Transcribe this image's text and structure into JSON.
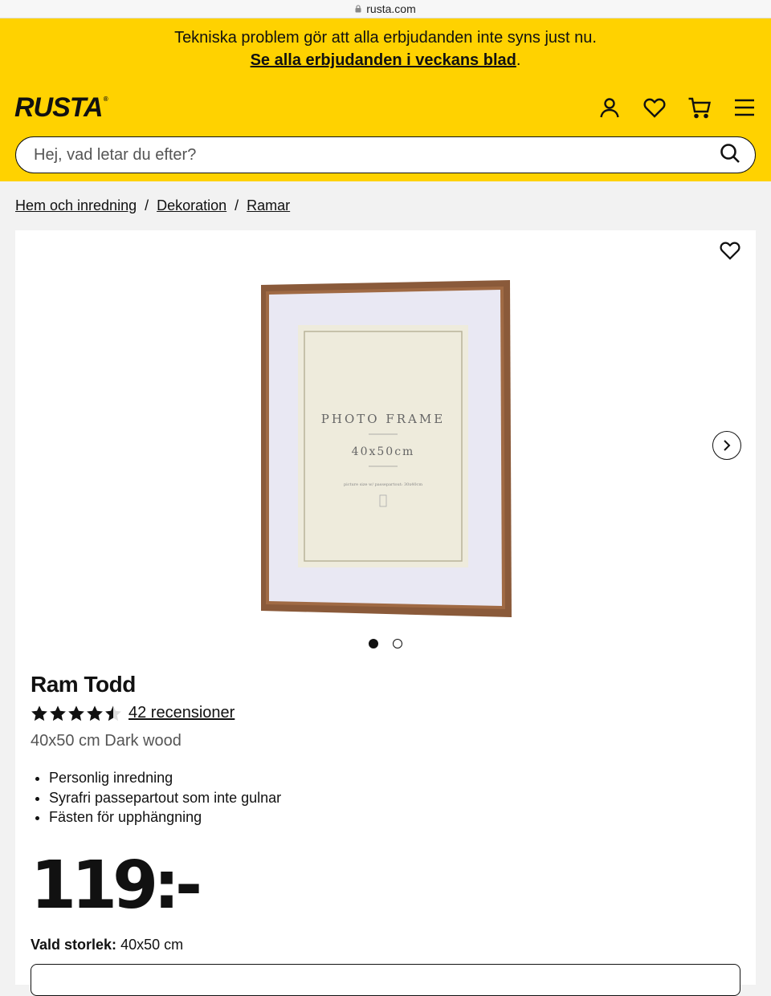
{
  "browser": {
    "url": "rusta.com"
  },
  "notice": {
    "line1": "Tekniska problem gör att alla erbjudanden inte syns just nu.",
    "link": "Se alla erbjudanden i veckans blad",
    "suffix": "."
  },
  "header": {
    "logo": "RUSTA",
    "logo_mark": "®",
    "icons": [
      "user-icon",
      "heart-icon",
      "cart-icon",
      "menu-icon"
    ]
  },
  "search": {
    "placeholder": "Hej, vad letar du efter?"
  },
  "breadcrumb": {
    "items": [
      "Hem och inredning",
      "Dekoration",
      "Ramar"
    ],
    "separator": "/"
  },
  "gallery": {
    "image_text": {
      "line1": "PHOTO FRAME",
      "line2": "40x50cm",
      "line3": "picture size w/ passepartout: 30x40cm"
    },
    "slides_total": 2,
    "active_slide": 1
  },
  "product": {
    "title": "Ram Todd",
    "rating": 4.5,
    "reviews_label": "42 recensioner",
    "subtitle": "40x50 cm Dark wood",
    "features": [
      "Personlig inredning",
      "Syrafri passepartout som inte gulnar",
      "Fästen för upphängning"
    ],
    "price": "119:-",
    "size_label": "Vald storlek:",
    "size_value": "40x50 cm"
  },
  "colors": {
    "brand_yellow": "#ffd200",
    "text": "#111111",
    "frame_wood": "#8a5a3a"
  }
}
